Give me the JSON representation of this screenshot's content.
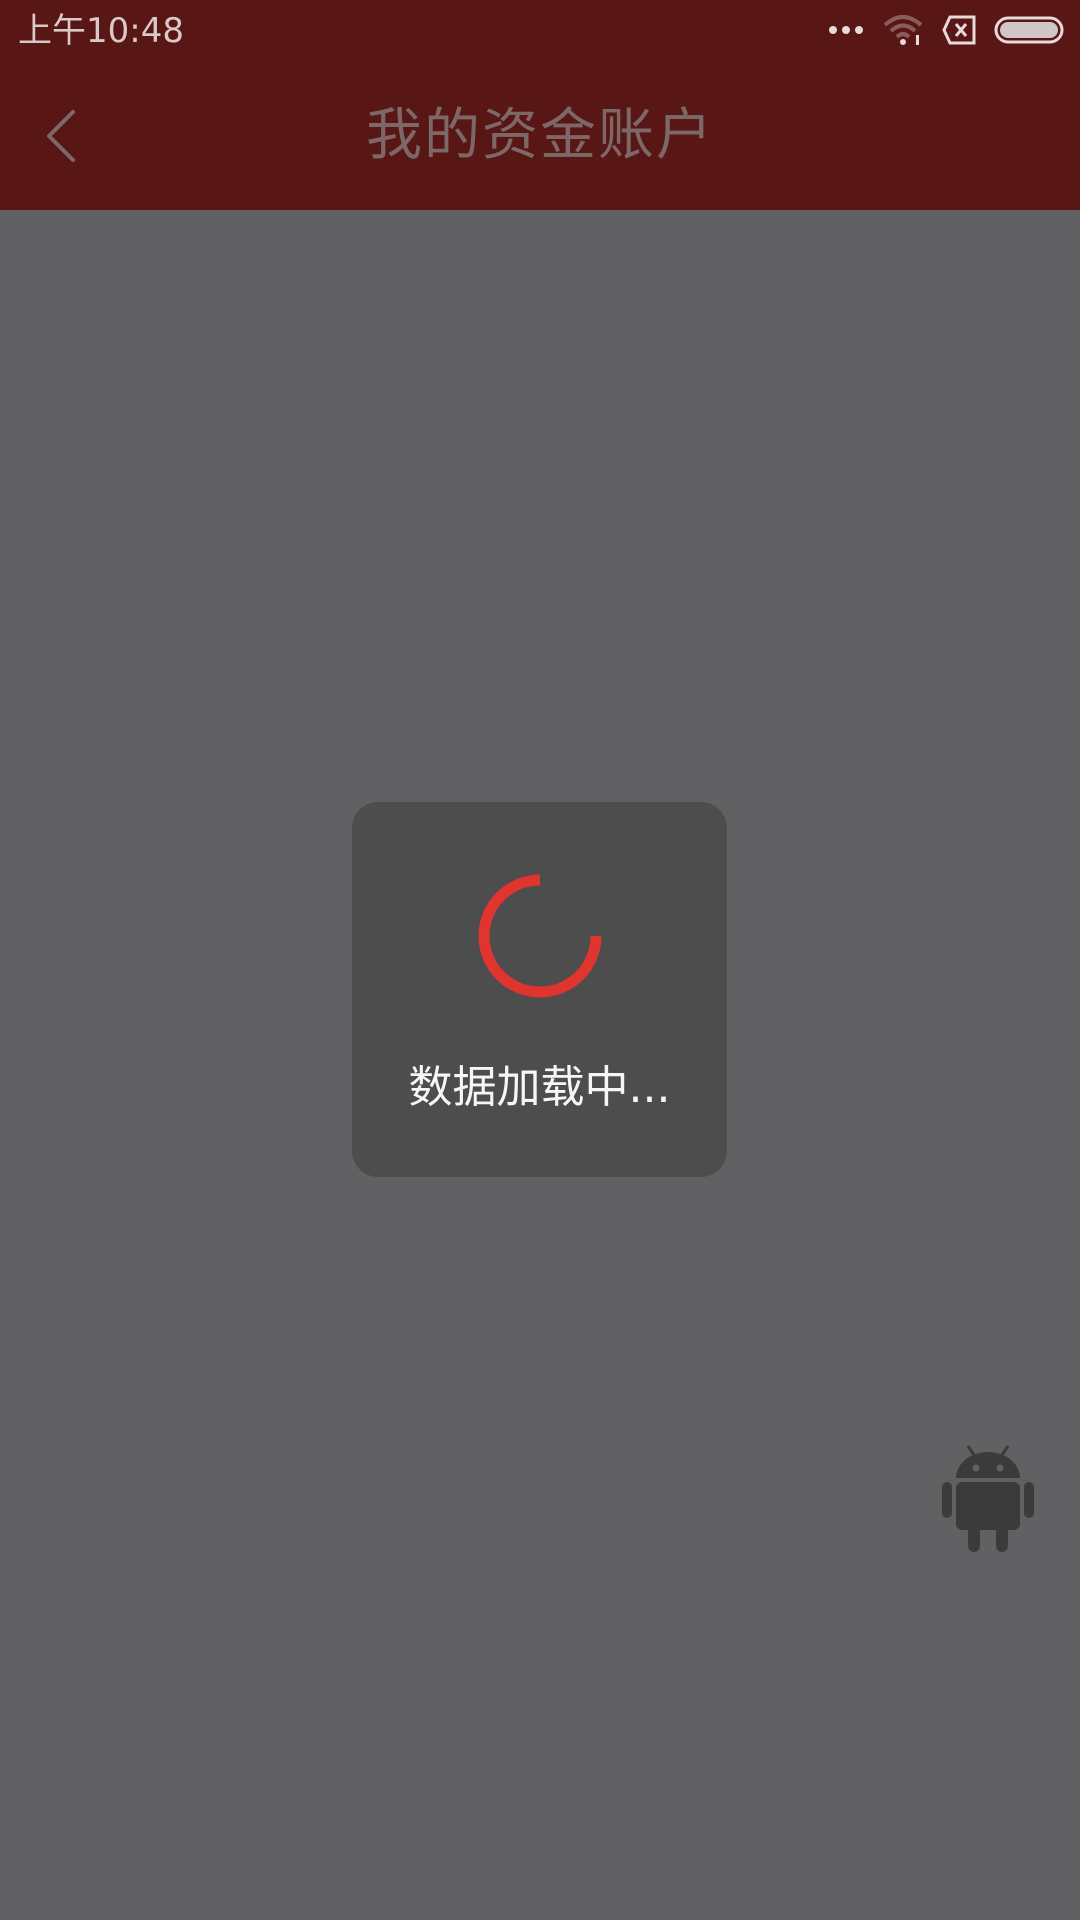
{
  "status_bar": {
    "time": "上午10:48",
    "icons": [
      "more-dots-icon",
      "wifi-icon",
      "no-sim-icon",
      "battery-icon"
    ]
  },
  "header": {
    "title": "我的资金账户",
    "back_icon": "chevron-left-icon"
  },
  "loading_dialog": {
    "text": "数据加载中...",
    "spinner_icon": "loading-spinner-icon"
  },
  "floating": {
    "icon": "android-icon"
  },
  "colors": {
    "header_bg": "#581615",
    "overlay_bg": "#616163",
    "dialog_bg": "#4d4d4e",
    "spinner": "#e0342f",
    "title_text": "#7d6767"
  }
}
